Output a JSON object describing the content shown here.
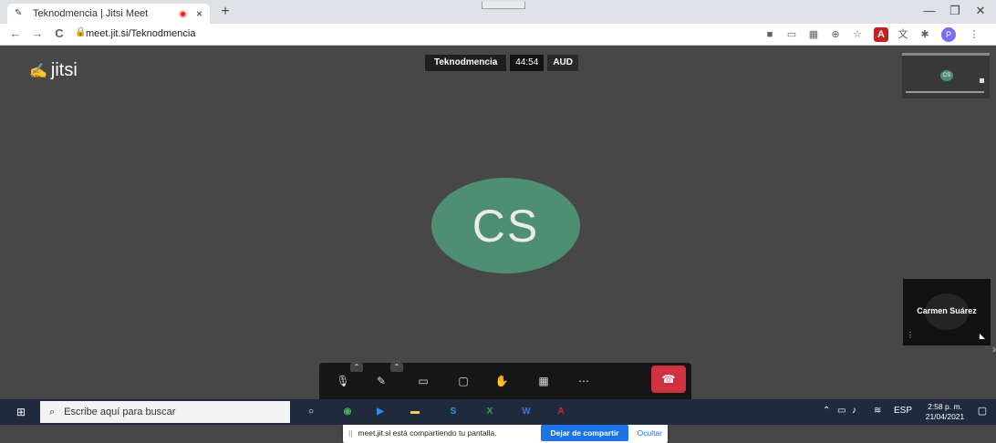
{
  "browser": {
    "tab_title": "Teknodmencia | Jitsi Meet",
    "tab_close": "×",
    "new_tab": "+",
    "url": "meet.jit.si/Teknodmencia",
    "window_controls": {
      "minimize": "—",
      "restore": "❐",
      "close": "✕"
    },
    "nav": {
      "back": "←",
      "forward": "→",
      "reload": "C"
    },
    "profile_initial": "P",
    "extensions": [
      "camera-icon",
      "cast-icon",
      "qr-icon",
      "install-icon",
      "star-icon",
      "acrobat-icon",
      "translate-icon",
      "puzzle-icon"
    ]
  },
  "meeting": {
    "logo_text": "jitsi",
    "subject": "Teknodmencia",
    "timer": "44:54",
    "badge": "AUD",
    "avatar_initials": "CS",
    "mini_avatar_initials": "CS",
    "participant_name": "Carmen Suárez",
    "avatar_color": "#4e8e73",
    "hangup_color": "#cf3141"
  },
  "share_bar": {
    "message": "meet.jit.si está compartiendo tu pantalla.",
    "stop_label": "Dejar de compartir",
    "hide_label": "Ocultar"
  },
  "taskbar": {
    "search_placeholder": "Escribe aquí para buscar",
    "language": "ESP",
    "time": "2:58 p. m.",
    "date": "21/04/2021",
    "apps": [
      "cortana-icon",
      "chrome-icon",
      "movies-icon",
      "file-explorer-icon",
      "skype-icon",
      "excel-icon",
      "word-icon",
      "acrobat-icon"
    ]
  }
}
